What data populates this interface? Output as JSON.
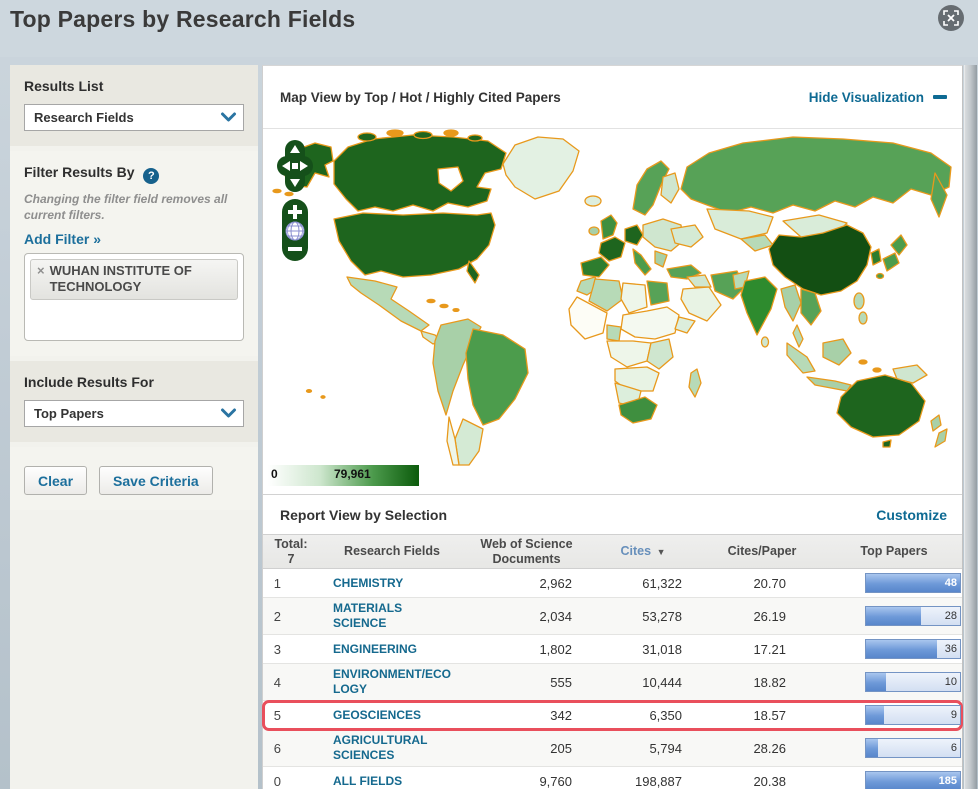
{
  "header": {
    "title": "Top Papers by Research Fields"
  },
  "sidebar": {
    "results_list": {
      "heading": "Results List",
      "dropdown_value": "Research Fields"
    },
    "filter": {
      "heading": "Filter Results By",
      "help_glyph": "?",
      "note": "Changing the filter field removes all current filters.",
      "add_filter_label": "Add Filter »",
      "tag": {
        "remove_glyph": "×",
        "label": "WUHAN INSTITUTE OF TECHNOLOGY"
      }
    },
    "include": {
      "heading": "Include Results For",
      "dropdown_value": "Top Papers"
    },
    "buttons": {
      "clear": "Clear",
      "save": "Save Criteria"
    }
  },
  "map_section": {
    "title": "Map View by  Top / Hot / Highly Cited Papers",
    "hide_link": "Hide Visualization",
    "legend": {
      "min": "0",
      "max": "79,961"
    },
    "colors": {
      "country_border": "#e8991c",
      "scale_low": "#ffffff",
      "scale_high": "#0d5c0d",
      "accent_link": "#0e6a93"
    }
  },
  "report": {
    "title": "Report View by Selection",
    "customize_link": "Customize",
    "columns": {
      "total_label": "Total:",
      "total_value": "7",
      "field": "Research Fields",
      "docs": "Web of Science Documents",
      "cites": "Cites",
      "sort_glyph": "▼",
      "cpp": "Cites/Paper",
      "top": "Top Papers"
    },
    "rows": [
      {
        "rank": "1",
        "field": "CHEMISTRY",
        "docs": "2,962",
        "cites": "61,322",
        "cpp": "20.70",
        "top_papers": "48",
        "bar_pct": 100,
        "highlighted": false
      },
      {
        "rank": "2",
        "field": "MATERIALS SCIENCE",
        "docs": "2,034",
        "cites": "53,278",
        "cpp": "26.19",
        "top_papers": "28",
        "bar_pct": 58,
        "highlighted": false
      },
      {
        "rank": "3",
        "field": "ENGINEERING",
        "docs": "1,802",
        "cites": "31,018",
        "cpp": "17.21",
        "top_papers": "36",
        "bar_pct": 75,
        "highlighted": false
      },
      {
        "rank": "4",
        "field": "ENVIRONMENT/ECOLOGY",
        "docs": "555",
        "cites": "10,444",
        "cpp": "18.82",
        "top_papers": "10",
        "bar_pct": 21,
        "highlighted": false
      },
      {
        "rank": "5",
        "field": "GEOSCIENCES",
        "docs": "342",
        "cites": "6,350",
        "cpp": "18.57",
        "top_papers": "9",
        "bar_pct": 19,
        "highlighted": true
      },
      {
        "rank": "6",
        "field": "AGRICULTURAL SCIENCES",
        "docs": "205",
        "cites": "5,794",
        "cpp": "28.26",
        "top_papers": "6",
        "bar_pct": 13,
        "highlighted": false
      },
      {
        "rank": "0",
        "field": "ALL FIELDS",
        "docs": "9,760",
        "cites": "198,887",
        "cpp": "20.38",
        "top_papers": "185",
        "bar_pct": 100,
        "highlighted": false
      }
    ]
  }
}
